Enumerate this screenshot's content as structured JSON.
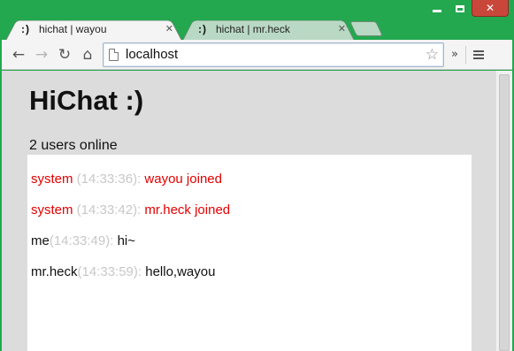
{
  "tabs": [
    {
      "favicon": ":)",
      "title": "hichat | wayou",
      "active": true
    },
    {
      "favicon": ":)",
      "title": "hichat | mr.heck",
      "active": false
    }
  ],
  "icons": {
    "close": "✕",
    "tab_close": "✕",
    "back": "←",
    "forward": "→",
    "reload": "↻",
    "home": "⌂",
    "star": "☆",
    "extensions": "»"
  },
  "toolbar": {
    "url": "localhost"
  },
  "page": {
    "title": "HiChat :)",
    "status": "2 users online",
    "messages": [
      {
        "sender": "system",
        "time": " (14:33:36): ",
        "text": "wayou joined",
        "type": "system"
      },
      {
        "sender": "system",
        "time": " (14:33:42): ",
        "text": "mr.heck joined",
        "type": "system"
      },
      {
        "sender": "me",
        "time": "(14:33:49): ",
        "text": "hi~",
        "type": "user"
      },
      {
        "sender": "mr.heck",
        "time": "(14:33:59): ",
        "text": "hello,wayou",
        "type": "user"
      }
    ]
  },
  "colors": {
    "frame": "#23a84f",
    "system_text": "#e30000",
    "timestamp": "#c8c8c8",
    "header_bg": "#dcdcdc"
  }
}
